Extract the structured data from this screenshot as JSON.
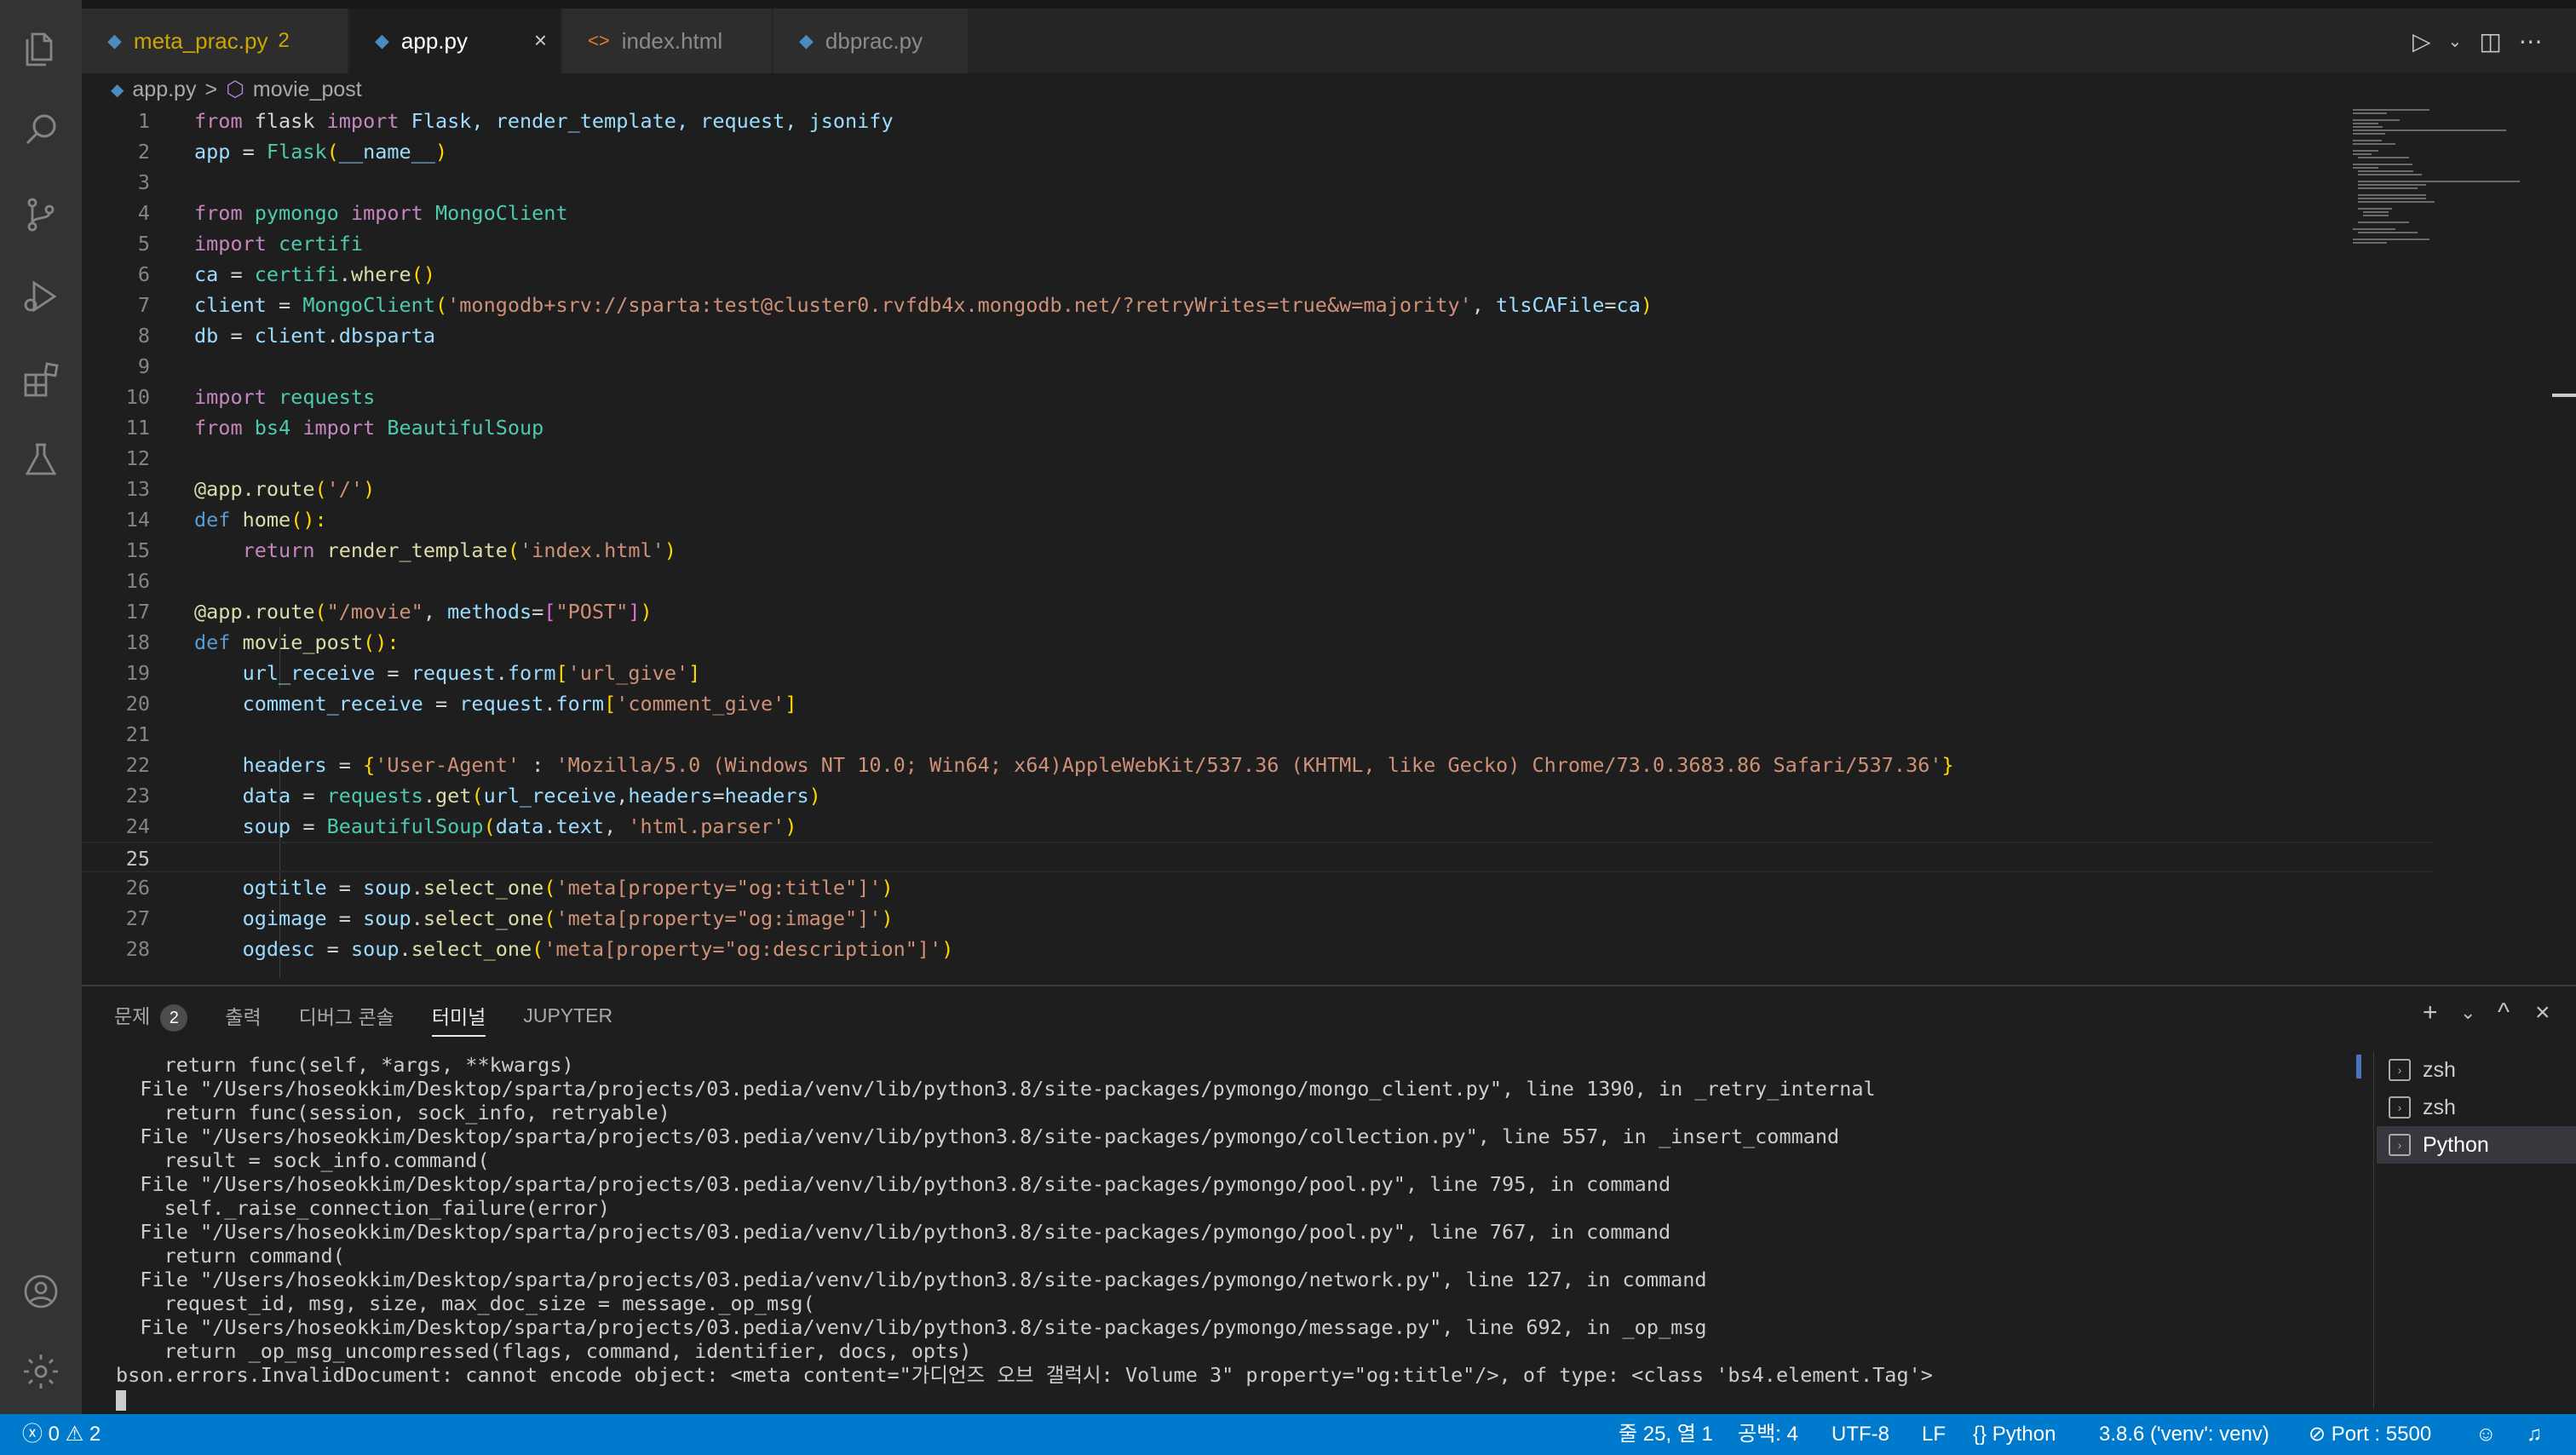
{
  "tabs": [
    {
      "label": "meta_prac.py",
      "badge": "2",
      "icon": "python-icon"
    },
    {
      "label": "app.py",
      "icon": "python-icon",
      "close": "×"
    },
    {
      "label": "index.html",
      "icon": "html-icon",
      "glyph": "<>"
    },
    {
      "label": "dbprac.py",
      "icon": "python-icon"
    }
  ],
  "breadcrumb": {
    "file": "app.py",
    "sep": ">",
    "symbol": "movie_post"
  },
  "code": {
    "line_numbers": [
      "1",
      "2",
      "3",
      "4",
      "5",
      "6",
      "7",
      "8",
      "9",
      "10",
      "11",
      "12",
      "13",
      "14",
      "15",
      "16",
      "17",
      "18",
      "19",
      "20",
      "21",
      "22",
      "23",
      "24",
      "25",
      "26",
      "27",
      "28"
    ],
    "tokens": {
      "l1": [
        "from",
        " flask ",
        "import",
        " Flask, render_template, request, jsonify"
      ],
      "l2": [
        "app",
        " = ",
        "Flask",
        "(",
        "__name__",
        ")"
      ],
      "l4": [
        "from",
        " pymongo ",
        "import",
        " MongoClient"
      ],
      "l5": [
        "import",
        " certifi"
      ],
      "l6": [
        "ca",
        " = ",
        "certifi",
        ".",
        "where",
        "()"
      ],
      "l7": [
        "client",
        " = ",
        "MongoClient",
        "(",
        "'mongodb+srv://sparta:test@cluster0.rvfdb4x.mongodb.net/?retryWrites=true&w=majority'",
        ", ",
        "tlsCAFile",
        "=",
        "ca",
        ")"
      ],
      "l8": [
        "db",
        " = ",
        "client",
        ".",
        "dbsparta"
      ],
      "l10": [
        "import",
        " requests"
      ],
      "l11": [
        "from",
        " bs4 ",
        "import",
        " BeautifulSoup"
      ],
      "l13": [
        "@app.route",
        "(",
        "'/'",
        ")"
      ],
      "l14": [
        "def",
        " ",
        "home",
        "():"
      ],
      "l15": [
        "    ",
        "return",
        " ",
        "render_template",
        "(",
        "'index.html'",
        ")"
      ],
      "l17": [
        "@app.route",
        "(",
        "\"/movie\"",
        ", ",
        "methods",
        "=",
        "[",
        "\"POST\"",
        "]",
        ")"
      ],
      "l18": [
        "def",
        " ",
        "movie_post",
        "():"
      ],
      "l19": [
        "    ",
        "url_receive",
        " = ",
        "request",
        ".",
        "form",
        "[",
        "'url_give'",
        "]"
      ],
      "l20": [
        "    ",
        "comment_receive",
        " = ",
        "request",
        ".",
        "form",
        "[",
        "'comment_give'",
        "]"
      ],
      "l22": [
        "    ",
        "headers",
        " = ",
        "{",
        "'User-Agent'",
        " : ",
        "'Mozilla/5.0 (Windows NT 10.0; Win64; x64)AppleWebKit/537.36 (KHTML, like Gecko) Chrome/73.0.3683.86 Safari/537.36'",
        "}"
      ],
      "l23": [
        "    ",
        "data",
        " = ",
        "requests",
        ".",
        "get",
        "(",
        "url_receive",
        ",",
        "headers",
        "=",
        "headers",
        ")"
      ],
      "l24": [
        "    ",
        "soup",
        " = ",
        "BeautifulSoup",
        "(",
        "data",
        ".",
        "text",
        ", ",
        "'html.parser'",
        ")"
      ],
      "l26": [
        "    ",
        "ogtitle",
        " = ",
        "soup",
        ".",
        "select_one",
        "(",
        "'meta[property=\"og:title\"]'",
        ")"
      ],
      "l27": [
        "    ",
        "ogimage",
        " = ",
        "soup",
        ".",
        "select_one",
        "(",
        "'meta[property=\"og:image\"]'",
        ")"
      ],
      "l28": [
        "    ",
        "ogdesc",
        " = ",
        "soup",
        ".",
        "select_one",
        "(",
        "'meta[property=\"og:description\"]'",
        ")"
      ]
    }
  },
  "panel": {
    "tabs": {
      "problems": "문제",
      "problems_count": "2",
      "output": "출력",
      "debug": "디버그 콘솔",
      "terminal": "터미널",
      "jupyter": "JUPYTER"
    },
    "terminal_lines": [
      "    return func(self, *args, **kwargs)",
      "  File \"/Users/hoseokkim/Desktop/sparta/projects/03.pedia/venv/lib/python3.8/site-packages/pymongo/mongo_client.py\", line 1390, in _retry_internal",
      "    return func(session, sock_info, retryable)",
      "  File \"/Users/hoseokkim/Desktop/sparta/projects/03.pedia/venv/lib/python3.8/site-packages/pymongo/collection.py\", line 557, in _insert_command",
      "    result = sock_info.command(",
      "  File \"/Users/hoseokkim/Desktop/sparta/projects/03.pedia/venv/lib/python3.8/site-packages/pymongo/pool.py\", line 795, in command",
      "    self._raise_connection_failure(error)",
      "  File \"/Users/hoseokkim/Desktop/sparta/projects/03.pedia/venv/lib/python3.8/site-packages/pymongo/pool.py\", line 767, in command",
      "    return command(",
      "  File \"/Users/hoseokkim/Desktop/sparta/projects/03.pedia/venv/lib/python3.8/site-packages/pymongo/network.py\", line 127, in command",
      "    request_id, msg, size, max_doc_size = message._op_msg(",
      "  File \"/Users/hoseokkim/Desktop/sparta/projects/03.pedia/venv/lib/python3.8/site-packages/pymongo/message.py\", line 692, in _op_msg",
      "    return _op_msg_uncompressed(flags, command, identifier, docs, opts)",
      "bson.errors.InvalidDocument: cannot encode object: <meta content=\"가디언즈 오브 갤럭시: Volume 3\" property=\"og:title\"/>, of type: <class 'bs4.element.Tag'>"
    ],
    "terminals": [
      "zsh",
      "zsh",
      "Python"
    ],
    "controls": {
      "add": "+",
      "chevron": "⌄",
      "maximize": "^",
      "close": "×"
    }
  },
  "status": {
    "errors": "0",
    "warnings": "2",
    "position": "줄 25, 열 1",
    "spaces": "공백: 4",
    "encoding": "UTF-8",
    "eol": "LF",
    "language": "Python",
    "interpreter": "3.8.6 ('venv': venv)",
    "port": "Port : 5500"
  },
  "colors": {
    "accent": "#007acc",
    "editor_bg": "#1e1e1e",
    "activity_bg": "#333333",
    "tab_inactive": "#2d2d2d",
    "warning_badge": "#cca700"
  }
}
